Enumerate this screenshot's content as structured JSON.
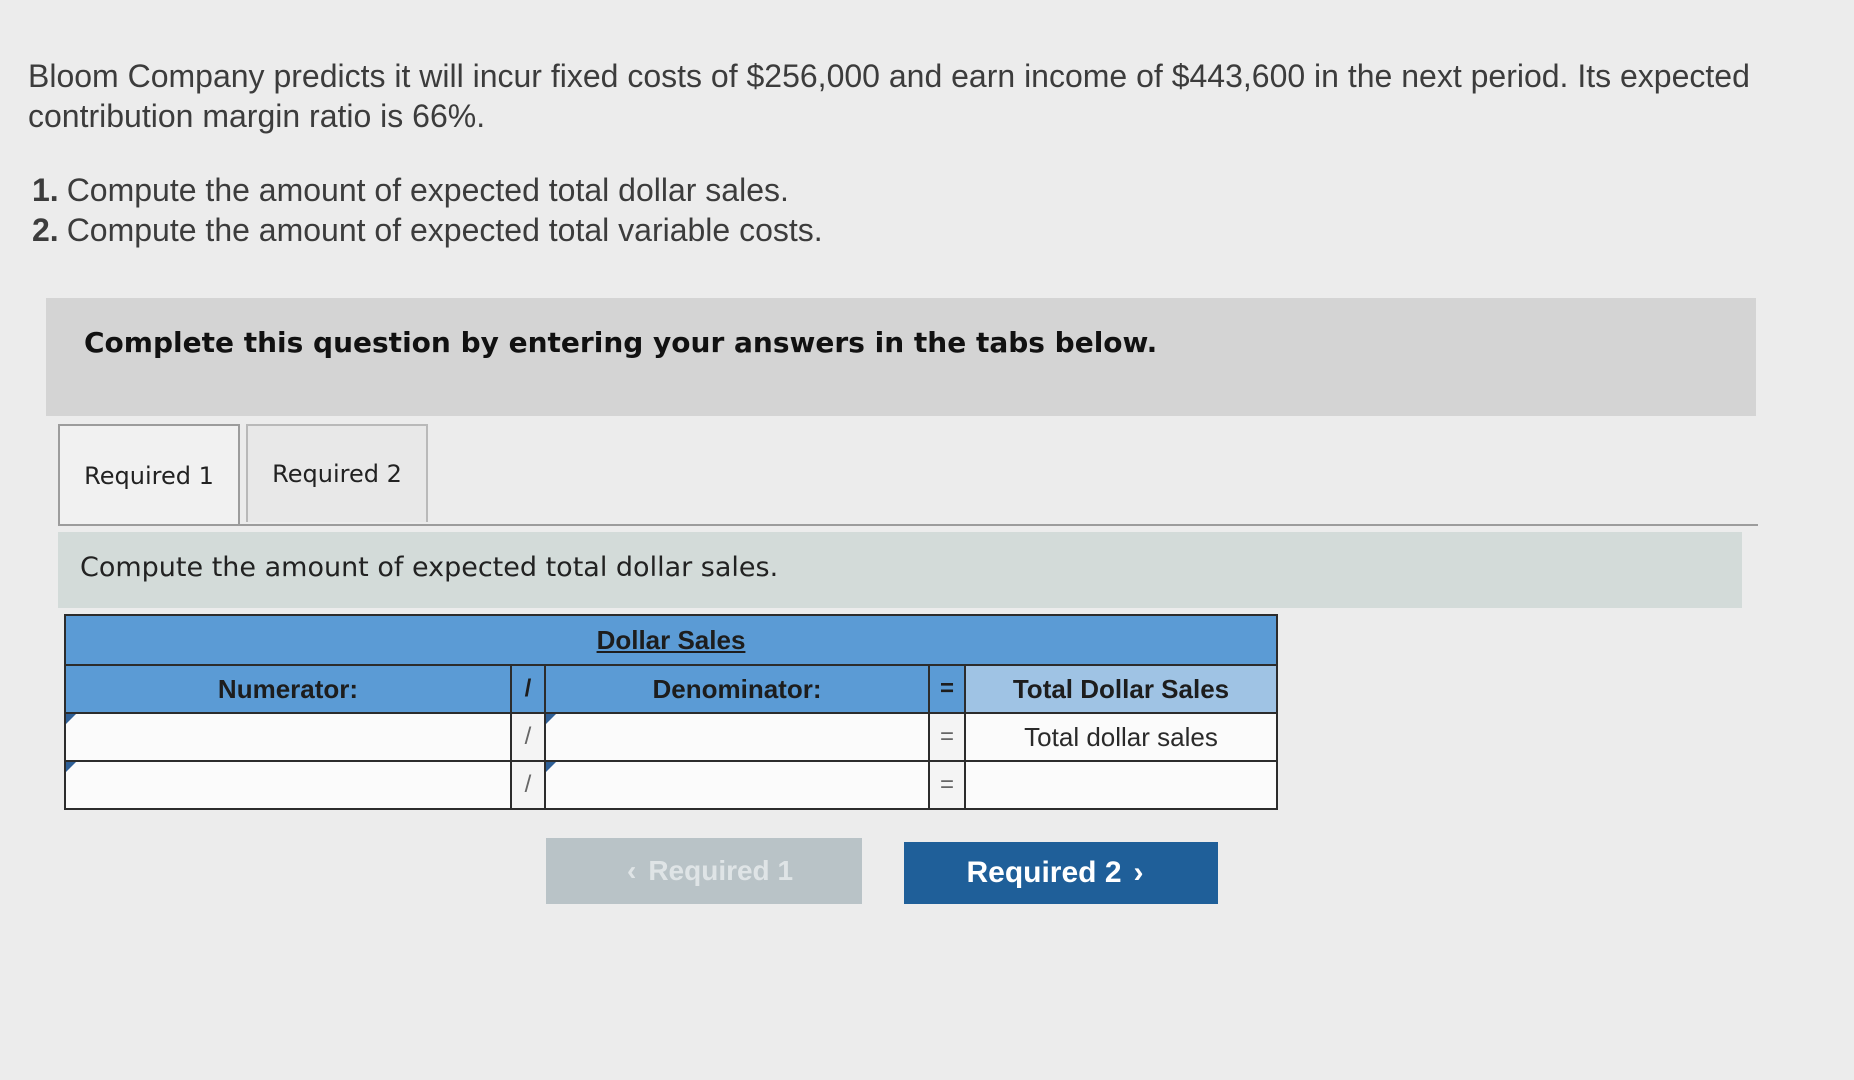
{
  "problem": {
    "line1": "Bloom Company predicts it will incur fixed costs of $256,000 and earn income of $443,600 in the next period. Its expected",
    "line2": "contribution margin ratio is 66%."
  },
  "requirements": [
    {
      "num": "1.",
      "text": "Compute the amount of expected total dollar sales."
    },
    {
      "num": "2.",
      "text": "Compute the amount of expected total variable costs."
    }
  ],
  "instructions": "Complete this question by entering your answers in the tabs below.",
  "tabs": [
    {
      "label": "Required 1",
      "active": true
    },
    {
      "label": "Required 2",
      "active": false
    }
  ],
  "panel": {
    "prompt": "Compute the amount of expected total dollar sales."
  },
  "table": {
    "title": "Dollar Sales",
    "headers": {
      "numerator": "Numerator:",
      "divide": "/",
      "denominator": "Denominator:",
      "equals": "=",
      "result": "Total Dollar Sales"
    },
    "rows": [
      {
        "numerator": "",
        "op": "/",
        "denominator": "",
        "eq": "=",
        "result": "Total dollar sales"
      },
      {
        "numerator": "",
        "op": "/",
        "denominator": "",
        "eq": "=",
        "result": ""
      }
    ]
  },
  "nav": {
    "prev_label": "Required 1",
    "next_label": "Required 2",
    "prev_icon": "chevron-left-icon",
    "next_icon": "chevron-right-icon"
  },
  "colors": {
    "table_header": "#5b9bd5",
    "next_button": "#1f5f99",
    "instructions_bg": "#d4d4d4",
    "panel_bg": "#d3dbd9"
  }
}
